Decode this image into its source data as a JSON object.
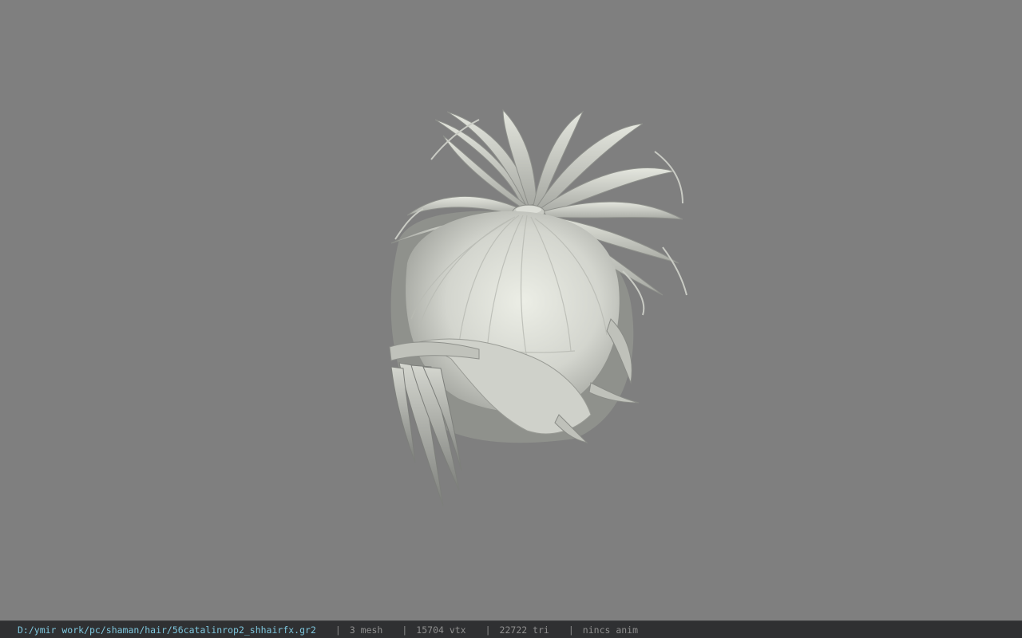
{
  "viewport": {
    "background_color": "#7f7f7f",
    "model_color": "#d9dbd4",
    "model_shadow_color": "#8e908b",
    "model_description": "hair-mesh-render"
  },
  "statusbar": {
    "file_path": "D:/ymir work/pc/shaman/hair/56catalinrop2_shhairfx.gr2",
    "separator": "|",
    "mesh_count": "3 mesh",
    "vertex_count": "15704 vtx",
    "triangle_count": "22722 tri",
    "animation": "nincs anim",
    "path_color": "#7ec6dd",
    "text_color": "#8f8f8f"
  }
}
